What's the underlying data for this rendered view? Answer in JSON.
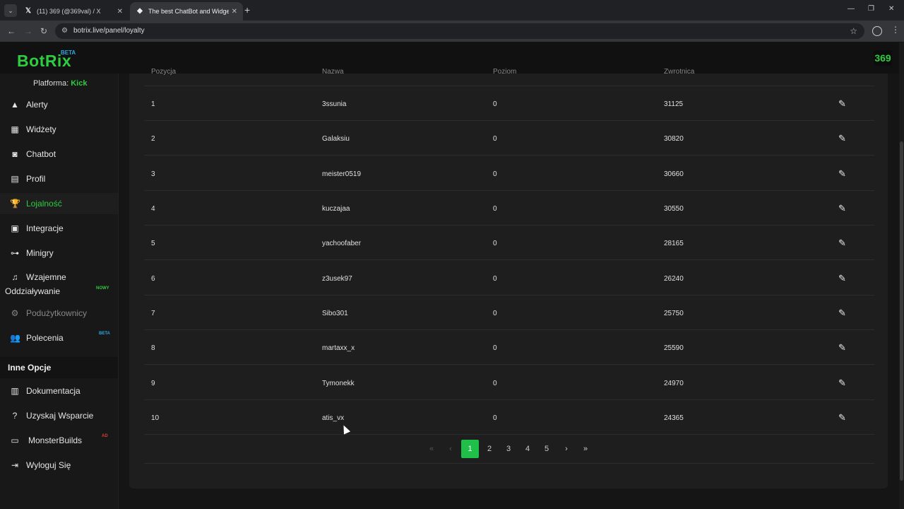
{
  "browser": {
    "tabs": [
      {
        "favicon": "x-logo-icon",
        "title": "(11) 369 (@369val) / X"
      },
      {
        "favicon": "botrix-icon",
        "title": "The best ChatBot and Widgets"
      }
    ],
    "url": "botrix.live/panel/loyalty"
  },
  "app": {
    "logo": "BotRix",
    "logo_badge": "BETA",
    "avatar_text": "369",
    "platform_label": "Platforma:",
    "platform_value": "Kick"
  },
  "sidebar": {
    "items": [
      {
        "label": "Alerty",
        "icon": "warning-icon"
      },
      {
        "label": "Widżety",
        "icon": "grid-icon"
      },
      {
        "label": "Chatbot",
        "icon": "robot-icon"
      },
      {
        "label": "Profil",
        "icon": "id-card-icon"
      },
      {
        "label": "Lojalność",
        "icon": "trophy-icon"
      },
      {
        "label": "Integracje",
        "icon": "integration-icon"
      },
      {
        "label": "Minigry",
        "icon": "gamepad-icon"
      },
      {
        "label": "Wzajemne",
        "label2": "Oddziaływanie",
        "icon": "music-icon",
        "badge": "NOWY"
      },
      {
        "label": "Podużytkownicy",
        "icon": "users-cog-icon"
      },
      {
        "label": "Polecenia",
        "icon": "users-icon",
        "badge": "BETA"
      }
    ],
    "section_title": "Inne Opcje",
    "other_items": [
      {
        "label": "Dokumentacja",
        "icon": "scroll-icon"
      },
      {
        "label": "Uzyskaj Wsparcie",
        "icon": "question-icon"
      },
      {
        "label": "MonsterBuilds",
        "icon": "laptop-icon",
        "badge": "AD"
      },
      {
        "label": "Wyloguj Się",
        "icon": "logout-icon"
      }
    ]
  },
  "table": {
    "headers": [
      "Pozycja",
      "Nazwa",
      "Poziom",
      "Zwrotnica"
    ],
    "rows": [
      {
        "pos": "1",
        "name": "3ssunia",
        "level": "0",
        "points": "31125"
      },
      {
        "pos": "2",
        "name": "Galaksiu",
        "level": "0",
        "points": "30820"
      },
      {
        "pos": "3",
        "name": "meister0519",
        "level": "0",
        "points": "30660"
      },
      {
        "pos": "4",
        "name": "kuczajaa",
        "level": "0",
        "points": "30550"
      },
      {
        "pos": "5",
        "name": "yachoofaber",
        "level": "0",
        "points": "28165"
      },
      {
        "pos": "6",
        "name": "z3usek97",
        "level": "0",
        "points": "26240"
      },
      {
        "pos": "7",
        "name": "Sibo301",
        "level": "0",
        "points": "25750"
      },
      {
        "pos": "8",
        "name": "martaxx_x",
        "level": "0",
        "points": "25590"
      },
      {
        "pos": "9",
        "name": "Tymonekk",
        "level": "0",
        "points": "24970"
      },
      {
        "pos": "10",
        "name": "atis_vx",
        "level": "0",
        "points": "24365"
      }
    ]
  },
  "pagination": {
    "first": "«",
    "prev": "‹",
    "pages": [
      "1",
      "2",
      "3",
      "4",
      "5"
    ],
    "current": "1",
    "next": "›",
    "last": "»"
  },
  "colors": {
    "accent": "#2ecc40",
    "active_page": "#1fbf4a",
    "badge_new": "#2ecc40",
    "badge_beta": "#2ea8e0",
    "badge_ad": "#e03a3a"
  }
}
